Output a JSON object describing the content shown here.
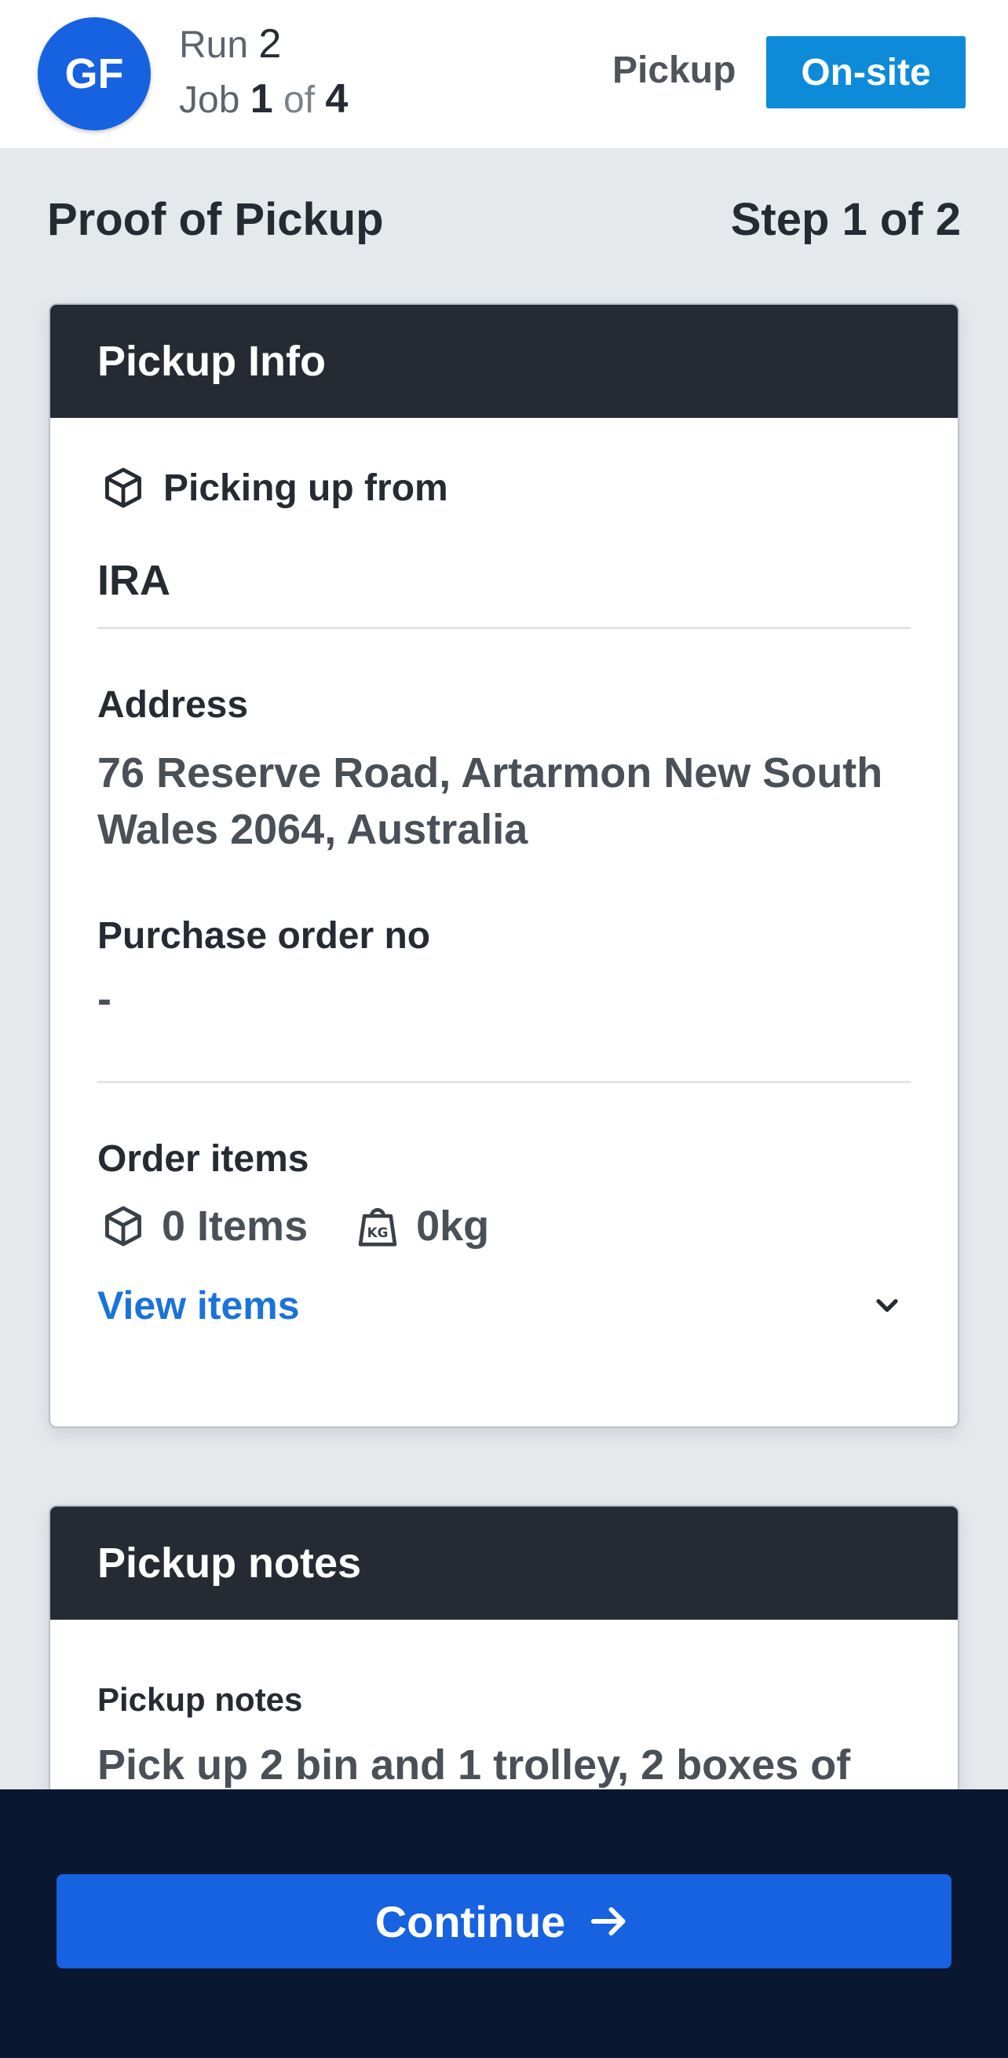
{
  "header": {
    "avatar_initials": "GF",
    "run_label": "Run",
    "run_number": "2",
    "job_label": "Job",
    "job_current": "1",
    "job_of": "of",
    "job_total": "4",
    "job_type": "Pickup",
    "status_badge": "On-site",
    "colors": {
      "avatar": "#1662e0",
      "status": "#0d8bd9"
    }
  },
  "page": {
    "title": "Proof of Pickup",
    "step": "Step 1 of 2"
  },
  "pickup_info": {
    "heading": "Pickup Info",
    "from_label": "Picking up from",
    "from_icon": "package-icon",
    "company": "IRA",
    "address_label": "Address",
    "address_value": "76 Reserve Road, Artarmon New South Wales 2064, Australia",
    "po_label": "Purchase order no",
    "po_value": "-",
    "order_items_label": "Order items",
    "items_count": "0 Items",
    "weight": "0kg",
    "view_items": "View items"
  },
  "pickup_notes": {
    "heading": "Pickup notes",
    "label": "Pickup notes",
    "value": "Pick up 2 bin and 1 trolley, 2 boxes of"
  },
  "footer": {
    "continue_label": "Continue",
    "continue_color": "#1662e0"
  }
}
